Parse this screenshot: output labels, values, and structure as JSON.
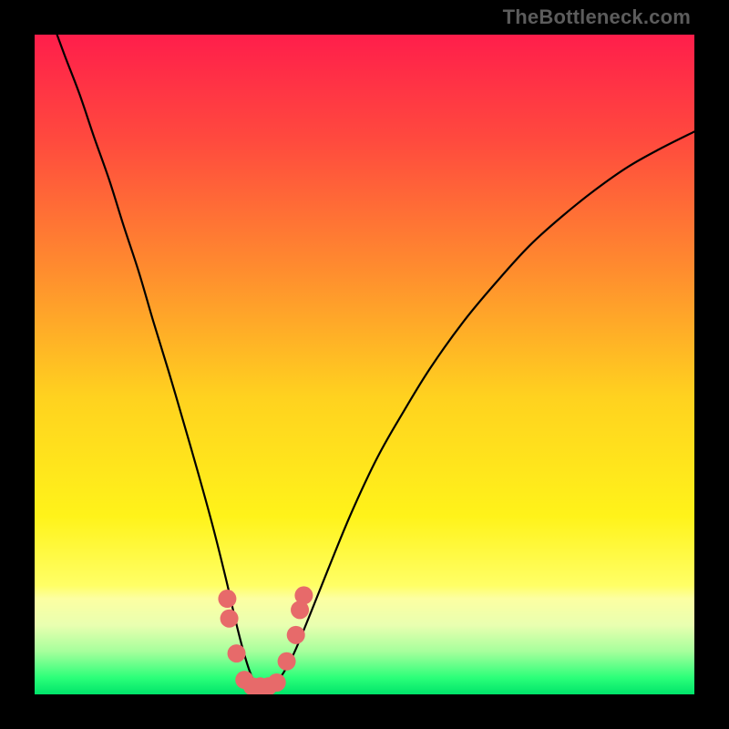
{
  "watermark": "TheBottleneck.com",
  "chart_data": {
    "type": "line",
    "title": "",
    "xlabel": "",
    "ylabel": "",
    "xlim": [
      0,
      1
    ],
    "ylim": [
      0,
      1
    ],
    "background_gradient_stops": [
      {
        "offset": 0.0,
        "color": "#ff1e4b"
      },
      {
        "offset": 0.16,
        "color": "#ff4a3e"
      },
      {
        "offset": 0.35,
        "color": "#ff8a2f"
      },
      {
        "offset": 0.55,
        "color": "#ffd21f"
      },
      {
        "offset": 0.73,
        "color": "#fff31a"
      },
      {
        "offset": 0.835,
        "color": "#ffff66"
      },
      {
        "offset": 0.855,
        "color": "#fcffa2"
      },
      {
        "offset": 0.895,
        "color": "#e9ffb0"
      },
      {
        "offset": 0.935,
        "color": "#a6ff9c"
      },
      {
        "offset": 0.975,
        "color": "#2bff79"
      },
      {
        "offset": 1.0,
        "color": "#00e46a"
      }
    ],
    "series": [
      {
        "name": "bottleneck-curve",
        "x": [
          0.023,
          0.045,
          0.068,
          0.09,
          0.113,
          0.135,
          0.158,
          0.18,
          0.203,
          0.225,
          0.248,
          0.27,
          0.29,
          0.305,
          0.318,
          0.33,
          0.342,
          0.356,
          0.372,
          0.392,
          0.415,
          0.445,
          0.48,
          0.52,
          0.56,
          0.6,
          0.65,
          0.7,
          0.75,
          0.8,
          0.85,
          0.9,
          0.95,
          1.0
        ],
        "y": [
          1.03,
          0.97,
          0.91,
          0.845,
          0.78,
          0.71,
          0.64,
          0.565,
          0.49,
          0.415,
          0.335,
          0.255,
          0.175,
          0.11,
          0.06,
          0.025,
          0.01,
          0.01,
          0.025,
          0.06,
          0.115,
          0.19,
          0.275,
          0.36,
          0.43,
          0.495,
          0.565,
          0.625,
          0.68,
          0.725,
          0.765,
          0.8,
          0.828,
          0.853
        ]
      }
    ],
    "markers": {
      "name": "highlight-dots",
      "color": "#e76a6a",
      "points": [
        {
          "x": 0.292,
          "y": 0.145
        },
        {
          "x": 0.295,
          "y": 0.115
        },
        {
          "x": 0.306,
          "y": 0.062
        },
        {
          "x": 0.318,
          "y": 0.022
        },
        {
          "x": 0.33,
          "y": 0.012
        },
        {
          "x": 0.342,
          "y": 0.012
        },
        {
          "x": 0.354,
          "y": 0.012
        },
        {
          "x": 0.367,
          "y": 0.018
        },
        {
          "x": 0.382,
          "y": 0.05
        },
        {
          "x": 0.396,
          "y": 0.09
        },
        {
          "x": 0.402,
          "y": 0.128
        },
        {
          "x": 0.408,
          "y": 0.15
        }
      ]
    }
  }
}
